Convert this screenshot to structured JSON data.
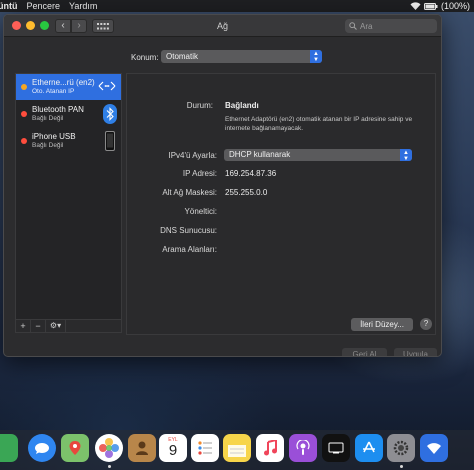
{
  "menubar": {
    "app": "üntü",
    "items": [
      "Pencere",
      "Yardım"
    ],
    "battery": "(100%)"
  },
  "window": {
    "title": "Ağ",
    "search_placeholder": "Ara",
    "location_label": "Konum:",
    "location_value": "Otomatik"
  },
  "services": [
    {
      "name": "Etherne...rü (en2)",
      "status": "Oto. Atanan IP",
      "dot_color": "#f5a623",
      "selected": true,
      "icon": "ethernet-arrows-icon"
    },
    {
      "name": "Bluetooth PAN",
      "status": "Bağlı Değil",
      "dot_color": "#ff4d3d",
      "selected": false,
      "icon": "bluetooth-icon"
    },
    {
      "name": "iPhone USB",
      "status": "Bağlı Değil",
      "dot_color": "#ff4d3d",
      "selected": false,
      "icon": "iphone-icon"
    }
  ],
  "sidebar_footer": {
    "add": "+",
    "remove": "−",
    "gear": "⚙▾"
  },
  "detail": {
    "status_label": "Durum:",
    "status_value": "Bağlandı",
    "status_desc": "Ethernet Adaptörü (en2) otomatik atanan bir IP adresine sahip ve internete bağlanamayacak.",
    "ipv4_label": "IPv4'ü Ayarla:",
    "ipv4_value": "DHCP kullanarak",
    "ip_label": "IP Adresi:",
    "ip_value": "169.254.87.36",
    "subnet_label": "Alt Ağ Maskesi:",
    "subnet_value": "255.255.0.0",
    "router_label": "Yöneltici:",
    "router_value": "",
    "dns_label": "DNS Sunucusu:",
    "dns_value": "",
    "search_domains_label": "Arama Alanları:",
    "search_domains_value": "",
    "advanced_button": "İleri Düzey...",
    "help": "?"
  },
  "buttons": {
    "revert": "Geri Al",
    "apply": "Uygula"
  },
  "dock": {
    "calendar_day": "9",
    "calendar_month": "EYL"
  }
}
